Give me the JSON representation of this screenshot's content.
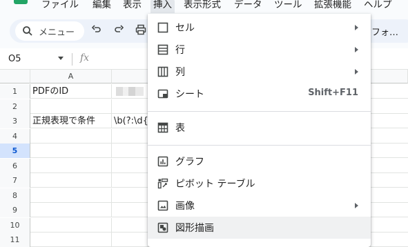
{
  "menubar": {
    "items": [
      "ファイル",
      "編集",
      "表示",
      "挿入",
      "表示形式",
      "データ",
      "ツール",
      "拡張機能",
      "ヘルプ"
    ],
    "active": "挿入"
  },
  "toolbar": {
    "search_label": "メニュー",
    "font_label": "フォ…"
  },
  "formula": {
    "namebox": "O5",
    "fx": "fx"
  },
  "grid": {
    "columns": [
      "A"
    ],
    "rows": [
      {
        "num": "1",
        "a": "PDFのID",
        "b": ""
      },
      {
        "num": "2",
        "a": "",
        "b": ""
      },
      {
        "num": "3",
        "a": "正規表現で条件",
        "b": "\\b(?:\\d{4"
      },
      {
        "num": "4",
        "a": "",
        "b": ""
      },
      {
        "num": "5",
        "a": "",
        "b": ""
      },
      {
        "num": "6",
        "a": "",
        "b": ""
      },
      {
        "num": "7",
        "a": "",
        "b": ""
      },
      {
        "num": "8",
        "a": "",
        "b": ""
      },
      {
        "num": "9",
        "a": "",
        "b": ""
      },
      {
        "num": "10",
        "a": "",
        "b": ""
      },
      {
        "num": "11",
        "a": "",
        "b": ""
      }
    ],
    "selected_row": "5"
  },
  "insert_menu": {
    "items": [
      {
        "label": "セル",
        "icon": "cell-icon",
        "submenu": true,
        "shortcut": ""
      },
      {
        "label": "行",
        "icon": "row-icon",
        "submenu": true,
        "shortcut": ""
      },
      {
        "label": "列",
        "icon": "column-icon",
        "submenu": true,
        "shortcut": ""
      },
      {
        "label": "シート",
        "icon": "sheet-icon",
        "submenu": false,
        "shortcut": "Shift+F11"
      },
      {
        "label": "表",
        "icon": "table-icon",
        "submenu": false,
        "shortcut": ""
      },
      {
        "label": "グラフ",
        "icon": "chart-icon",
        "submenu": false,
        "shortcut": ""
      },
      {
        "label": "ピボット テーブル",
        "icon": "pivot-table-icon",
        "submenu": false,
        "shortcut": ""
      },
      {
        "label": "画像",
        "icon": "image-icon",
        "submenu": true,
        "shortcut": ""
      },
      {
        "label": "図形描画",
        "icon": "drawing-icon",
        "submenu": false,
        "shortcut": ""
      }
    ]
  },
  "colors": {
    "accent": "#0b57d0",
    "sheets_green": "#23a566",
    "selected_row_bg": "#d3e3fd"
  }
}
